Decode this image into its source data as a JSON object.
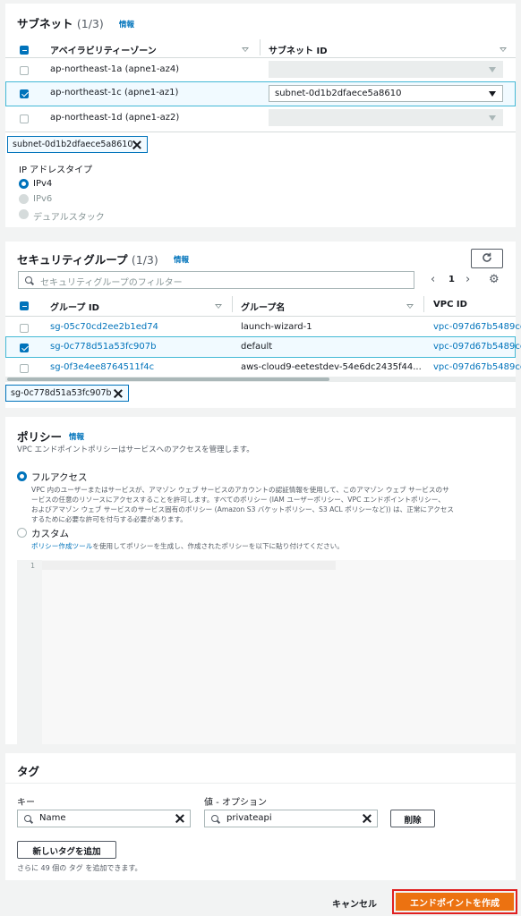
{
  "subnets": {
    "title": "サブネット",
    "count": "(1/3)",
    "info": "情報",
    "col_az": "アベイラビリティーゾーン",
    "col_subnet": "サブネット ID",
    "rows": [
      {
        "az": "ap-northeast-1a (apne1-az4)",
        "subnet": "",
        "checked": false
      },
      {
        "az": "ap-northeast-1c (apne1-az1)",
        "subnet": "subnet-0d1b2dfaece5a8610",
        "checked": true
      },
      {
        "az": "ap-northeast-1d (apne1-az2)",
        "subnet": "",
        "checked": false
      }
    ],
    "token": "subnet-0d1b2dfaece5a8610",
    "ip_label": "IP アドレスタイプ",
    "ip_options": [
      "IPv4",
      "IPv6",
      "デュアルスタック"
    ]
  },
  "security_groups": {
    "title": "セキュリティグループ",
    "count": "(1/3)",
    "info": "情報",
    "filter_placeholder": "セキュリティグループのフィルター",
    "page": "1",
    "col_id": "グループ ID",
    "col_name": "グループ名",
    "col_vpc": "VPC ID",
    "rows": [
      {
        "id": "sg-05c70cd2ee2b1ed74",
        "name": "launch-wizard-1",
        "vpc": "vpc-097d67b5489ce",
        "checked": false
      },
      {
        "id": "sg-0c778d51a53fc907b",
        "name": "default",
        "vpc": "vpc-097d67b5489ce",
        "checked": true
      },
      {
        "id": "sg-0f3e4ee8764511f4c",
        "name": "aws-cloud9-eetestdev-54e6dc2435f44...",
        "vpc": "vpc-097d67b5489ce",
        "checked": false
      }
    ],
    "token": "sg-0c778d51a53fc907b"
  },
  "policy": {
    "title": "ポリシー",
    "info": "情報",
    "description": "VPC エンドポイントポリシーはサービスへのアクセスを管理します。",
    "full_label": "フルアクセス",
    "full_desc_1": "VPC 内のユーザーまたはサービスが、アマゾン ウェブ サービスのアカウントの認証情報を使用して、このアマゾン ウェブ サービスのサ",
    "full_desc_2": "ービスの任意のリソースにアクセスすることを許可します。すべてのポリシー (IAM ユーザーポリシー、VPC エンドポイントポリシー、",
    "full_desc_3": "およびアマゾン ウェブ サービスのサービス固有のポリシー (Amazon S3 バケットポリシー、S3 ACL ポリシーなど)) は、正常にアクセス",
    "full_desc_4": "するために必要な許可を付与する必要があります。",
    "custom_label": "カスタム",
    "custom_link": "ポリシー作成ツール",
    "custom_desc": "を使用してポリシーを生成し、作成されたポリシーを以下に貼り付けてください。",
    "line_number": "1"
  },
  "tags": {
    "title": "タグ",
    "key_label": "キー",
    "value_label": "値 - オプション",
    "key_value": "Name",
    "value_value": "privateapi",
    "remove_label": "削除",
    "add_label": "新しいタグを追加",
    "hint": "さらに 49 個の タグ を追加できます。"
  },
  "footer": {
    "cancel": "キャンセル",
    "create": "エンドポイントを作成"
  }
}
